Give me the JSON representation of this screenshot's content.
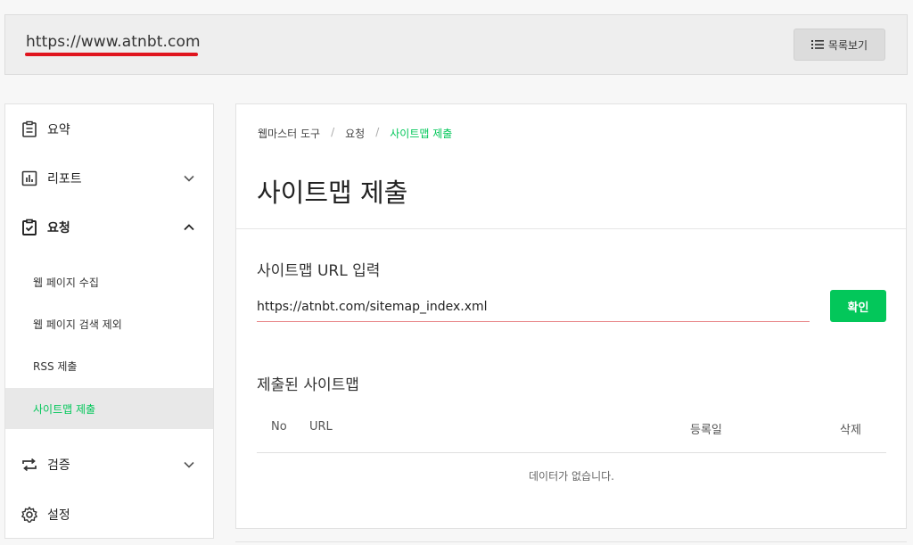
{
  "site": {
    "url": "https://www.atnbt.com",
    "list_button": "목록보기",
    "list_icon": "list-icon",
    "underline_color": "#e0151e"
  },
  "sidebar": {
    "summary": {
      "label": "요약",
      "icon": "clipboard-icon"
    },
    "report": {
      "label": "리포트",
      "icon": "bar-chart-icon"
    },
    "request": {
      "label": "요청",
      "icon": "checked-clipboard-icon",
      "items": [
        {
          "label": "웹 페이지 수집"
        },
        {
          "label": "웹 페이지 검색 제외"
        },
        {
          "label": "RSS 제출"
        },
        {
          "label": "사이트맵 제출",
          "active": true
        }
      ]
    },
    "verify": {
      "label": "검증",
      "icon": "repeat-icon"
    },
    "settings": {
      "label": "설정",
      "icon": "gear-icon"
    }
  },
  "main": {
    "breadcrumb": [
      "웹마스터 도구",
      "요청",
      "사이트맵 제출"
    ],
    "title": "사이트맵 제출",
    "input_section_title": "사이트맵 URL 입력",
    "input_value": "https://atnbt.com/sitemap_index.xml",
    "confirm_button": "확인",
    "submitted_title": "제출된 사이트맵",
    "table": {
      "columns": [
        "No",
        "URL",
        "등록일",
        "삭제"
      ],
      "empty_message": "데이터가 없습니다."
    }
  },
  "colors": {
    "accent": "#03c75a",
    "input_underline": "#e8888a"
  }
}
